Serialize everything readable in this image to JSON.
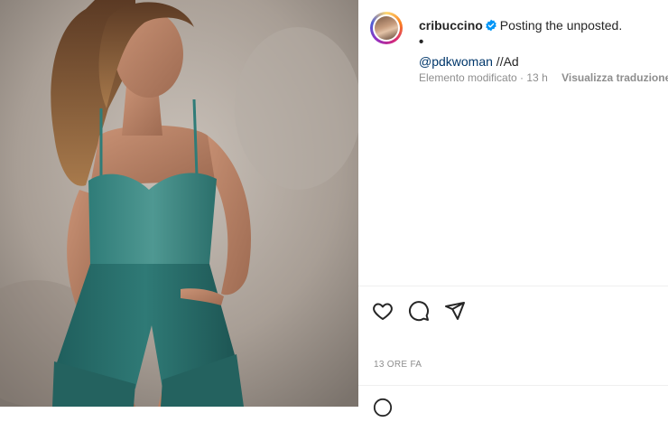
{
  "post": {
    "username": "cribuccino",
    "caption_text": "Posting the unposted.",
    "caption_dot": "•",
    "mention": "@pdkwoman",
    "ad_tag": " //Ad",
    "meta_text": "Elemento modificato · 13 h",
    "translate_label": "Visualizza traduzione",
    "timestamp": "13 ORE FA"
  },
  "icons": {
    "verified": "verified-badge-icon",
    "like": "heart-icon",
    "comment": "comment-icon",
    "share": "paper-plane-icon",
    "emoji": "smiley-icon"
  },
  "colors": {
    "verified": "#0095f6",
    "mention": "#00376b",
    "meta": "#8e8e8e"
  }
}
